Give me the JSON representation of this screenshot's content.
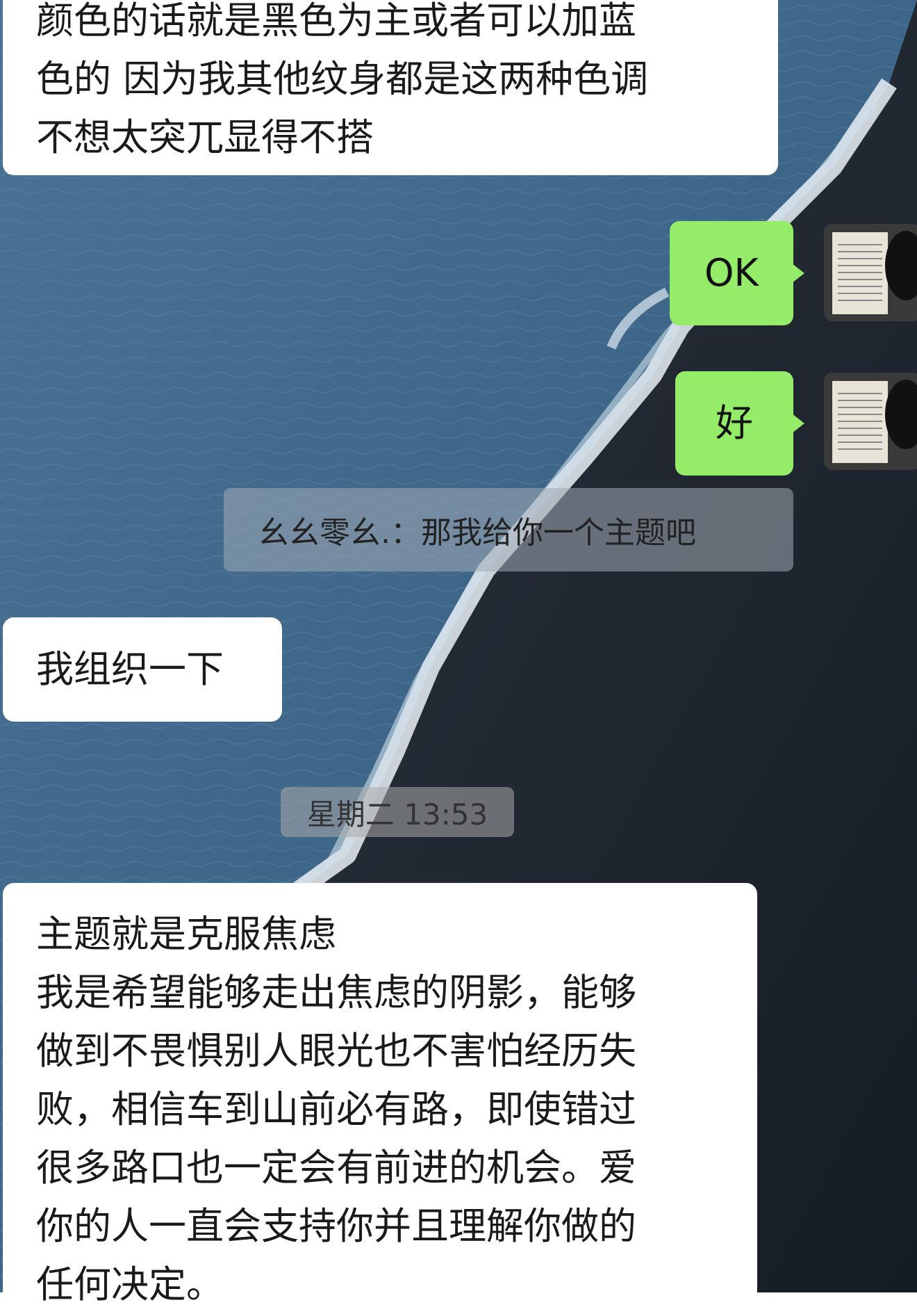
{
  "messages": [
    {
      "id": "msg1",
      "side": "received",
      "text": "颜色的话就是黑色为主或者可以加蓝\n色的 因为我其他纹身都是这两种色调\n不想太突兀显得不搭"
    },
    {
      "id": "msg2",
      "side": "sent",
      "text": "OK"
    },
    {
      "id": "msg3",
      "side": "sent",
      "text": "好"
    },
    {
      "id": "msg4",
      "side": "quote",
      "text": "幺幺零幺.：那我给你一个主题吧"
    },
    {
      "id": "msg5",
      "side": "received",
      "text": "我组织一下"
    },
    {
      "id": "msg6",
      "side": "received",
      "text": "主题就是克服焦虑\n我是希望能够走出焦虑的阴影，能够\n做到不畏惧别人眼光也不害怕经历失\n败，相信车到山前必有路，即使错过\n很多路口也一定会有前进的机会。爱\n你的人一直会支持你并且理解你做的\n任何决定。"
    }
  ],
  "timestamp": "星期二 13:53",
  "colors": {
    "sent_bubble": "#95ec69",
    "received_bubble": "#ffffff",
    "sea": "#3f6486",
    "sand": "#1e2630"
  },
  "icons": {
    "avatar": "book-avatar-icon"
  }
}
